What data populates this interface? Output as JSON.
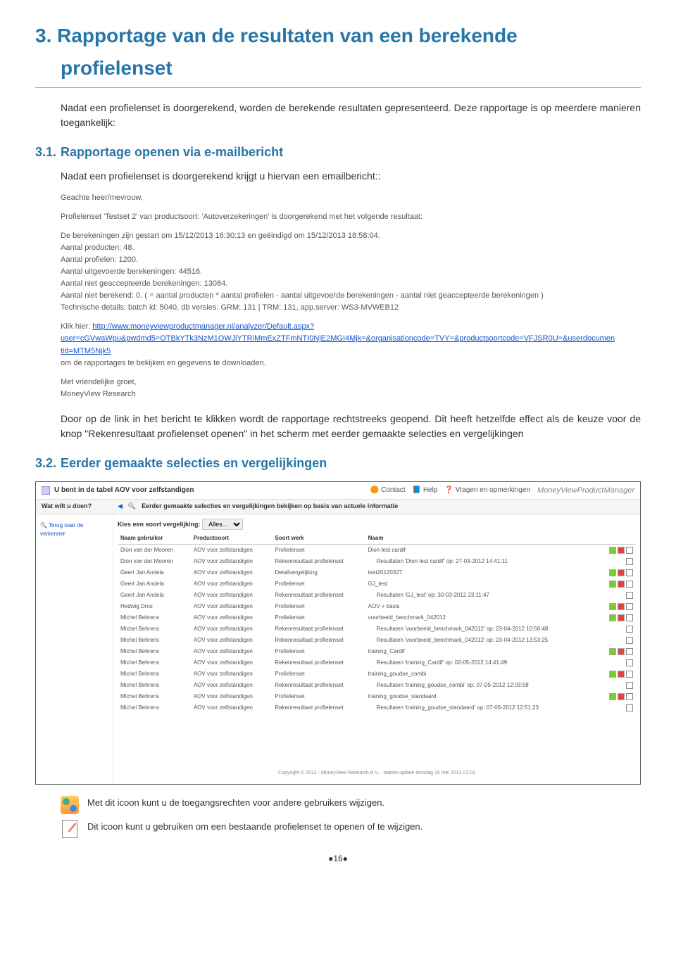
{
  "section": {
    "number": "3.",
    "title_line1": "Rapportage van de resultaten van een berekende",
    "title_line2": "profielenset"
  },
  "intro_text": "Nadat een profielenset is doorgerekend, worden de berekende resultaten gepresenteerd. Deze rapportage is op meerdere manieren toegankelijk:",
  "sub1": {
    "number": "3.1.",
    "title": "Rapportage openen via e-mailbericht",
    "lead": "Nadat een profielenset is doorgerekend krijgt u hiervan een emailbericht::"
  },
  "email": {
    "greeting": "Geachte heer/mevrouw,",
    "line_product": "Profielenset 'Testset  2' van productsoort: 'Autoverzekeringen' is doorgerekend met het volgende resultaat:",
    "lines": [
      "De berekeningen zijn gestart om 15/12/2013 16:30:13 en geëindigd om 15/12/2013 18:58:04.",
      "Aantal producten: 48.",
      "Aantal profielen: 1200.",
      "Aantal uitgevoerde berekeningen: 44516.",
      "Aantal niet geaccepteerde berekeningen: 13084.",
      "Aantal niet berekend: 0. ( = aantal producten * aantal profielen - aantal uitgevoerde berekeningen - aantal niet geaccepteerde berekeningen )",
      "Technische details: batch id: 5040, db versies: GRM: 131 | TRM: 131, app.server: WS3-MVWEB12"
    ],
    "link_label": "Klik hier: ",
    "link1": "http://www.moneyviewproductmanager.nl/analyzer/Default.aspx?",
    "link2": "user=cGVwaWpu&pwdmd5=OTBkYTk3NzM1OWJiYTRiMmExZTFmNTI0NjE2MGI4Mjk=&organisationcode=TVY=&productsoortcode=VFJSR0U=&userdocumentid=MTM5Njk5",
    "link_after": "om de rapportages te bekijken en gegevens te downloaden.",
    "closing1": "Met vriendelijke groet,",
    "closing2": "MoneyView Research"
  },
  "after_email": "Door op de link in het bericht te klikken wordt de rapportage rechtstreeks geopend. Dit heeft hetzelfde effect als de keuze voor de knop \"Rekenresultaat profielenset openen\" in het scherm met eerder gemaakte selecties en vergelijkingen",
  "sub2": {
    "number": "3.2.",
    "title": "Eerder gemaakte selecties en vergelijkingen"
  },
  "screenshot": {
    "top_title": "U bent in de tabel AOV voor zelfstandigen",
    "top_links": {
      "contact": "Contact",
      "help": "Help",
      "faq": "Vragen en opmerkingen"
    },
    "brand": "MoneyView",
    "brand_sub": "ProductManager",
    "second_row": "Eerder gemaakte selecties en vergelijkingen bekijken op basis van actuele informatie",
    "left_sidebar": {
      "wat": "Wat wilt u doen?",
      "terug": "Terug naar de verkenner"
    },
    "filter_label": "Kies een soort vergelijking:",
    "filter_value": "Alles...",
    "columns": [
      "Naam gebruiker",
      "Productsoort",
      "Soort werk",
      "Naam"
    ],
    "rows": [
      {
        "user": "Dion van der Mooren",
        "prod": "AOV voor zelfstandigen",
        "soort": "Profielenset",
        "naam": "Dion test cardif",
        "indent": false
      },
      {
        "user": "Dion van der Mooren",
        "prod": "AOV voor zelfstandigen",
        "soort": "Rekenresultaat profielenset",
        "naam": "Resultaten 'Dion test cardif' op: 27-03-2012 14:41:11",
        "indent": true
      },
      {
        "user": "Geert Jan Andela",
        "prod": "AOV voor zelfstandigen",
        "soort": "Detailvergelijking",
        "naam": "test20120327",
        "indent": false
      },
      {
        "user": "Geert Jan Andela",
        "prod": "AOV voor zelfstandigen",
        "soort": "Profielenset",
        "naam": "GJ_test",
        "indent": false
      },
      {
        "user": "Geert Jan Andela",
        "prod": "AOV voor zelfstandigen",
        "soort": "Rekenresultaat profielenset",
        "naam": "Resultaten 'GJ_test' op: 30-03-2012 23:11:47",
        "indent": true
      },
      {
        "user": "Hedwig Dros",
        "prod": "AOV voor zelfstandigen",
        "soort": "Profielenset",
        "naam": "AOV + basis",
        "indent": false
      },
      {
        "user": "Michel Behrens",
        "prod": "AOV voor zelfstandigen",
        "soort": "Profielenset",
        "naam": "voorbeeld_benchmark_042012",
        "indent": false
      },
      {
        "user": "Michel Behrens",
        "prod": "AOV voor zelfstandigen",
        "soort": "Rekenresultaat profielenset",
        "naam": "Resultaten 'voorbeeld_benchmark_042012' op: 23-04-2012 10:56:48",
        "indent": true
      },
      {
        "user": "Michel Behrens",
        "prod": "AOV voor zelfstandigen",
        "soort": "Rekenresultaat profielenset",
        "naam": "Resultaten 'voorbeeld_benchmark_042012' op: 23-04-2012 13:53:25",
        "indent": true
      },
      {
        "user": "Michel Behrens",
        "prod": "AOV voor zelfstandigen",
        "soort": "Profielenset",
        "naam": "training_Cardif",
        "indent": false
      },
      {
        "user": "Michel Behrens",
        "prod": "AOV voor zelfstandigen",
        "soort": "Rekenresultaat profielenset",
        "naam": "Resultaten 'training_Cardif' op: 02-05-2012 14:41:49",
        "indent": true
      },
      {
        "user": "Michel Behrens",
        "prod": "AOV voor zelfstandigen",
        "soort": "Profielenset",
        "naam": "training_goudse_combi",
        "indent": false
      },
      {
        "user": "Michel Behrens",
        "prod": "AOV voor zelfstandigen",
        "soort": "Rekenresultaat profielenset",
        "naam": "Resultaten 'training_goudse_combi' op: 07-05-2012 12:03:58",
        "indent": true
      },
      {
        "user": "Michel Behrens",
        "prod": "AOV voor zelfstandigen",
        "soort": "Profielenset",
        "naam": "training_goudse_standaard",
        "indent": false
      },
      {
        "user": "Michel Behrens",
        "prod": "AOV voor zelfstandigen",
        "soort": "Rekenresultaat profielenset",
        "naam": "Resultaten 'training_goudse_standaard' op: 07-05-2012 12:51:23",
        "indent": true
      }
    ],
    "footer": "Copyright © 2012 - MoneyView Research B.V. - laatste update dinsdag 15 mei 2012 01:02"
  },
  "icon_desc": {
    "users": "Met dit icoon kunt u de toegangsrechten voor andere gebruikers wijzigen.",
    "edit": "Dit icoon kunt u gebruiken om een bestaande profielenset te openen of te wijzigen."
  },
  "page_number": "●16●"
}
